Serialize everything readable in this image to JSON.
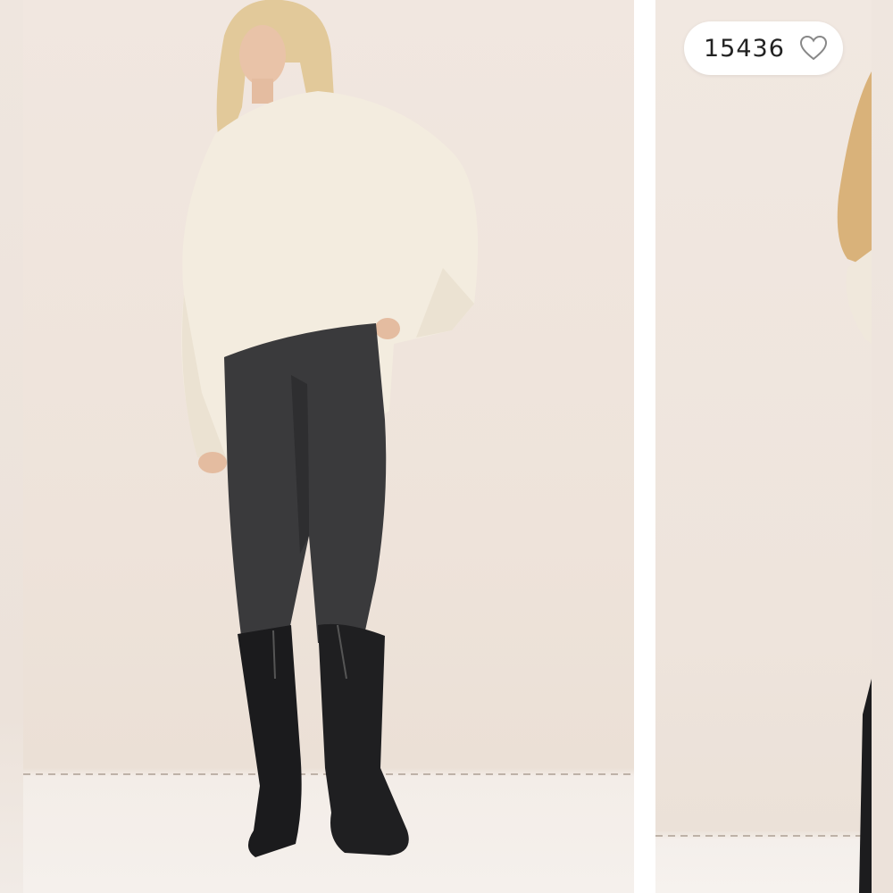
{
  "listing": {
    "likes_count": "15436",
    "like_icon": "heart-outline-icon"
  },
  "colors": {
    "pill_bg": "#ffffff",
    "pill_text": "#222222",
    "heart_stroke": "#888888",
    "backdrop": "#efe5dd"
  },
  "gallery": {
    "images": [
      {
        "label": "previous-photo"
      },
      {
        "label": "current-photo"
      },
      {
        "label": "next-photo"
      }
    ]
  }
}
